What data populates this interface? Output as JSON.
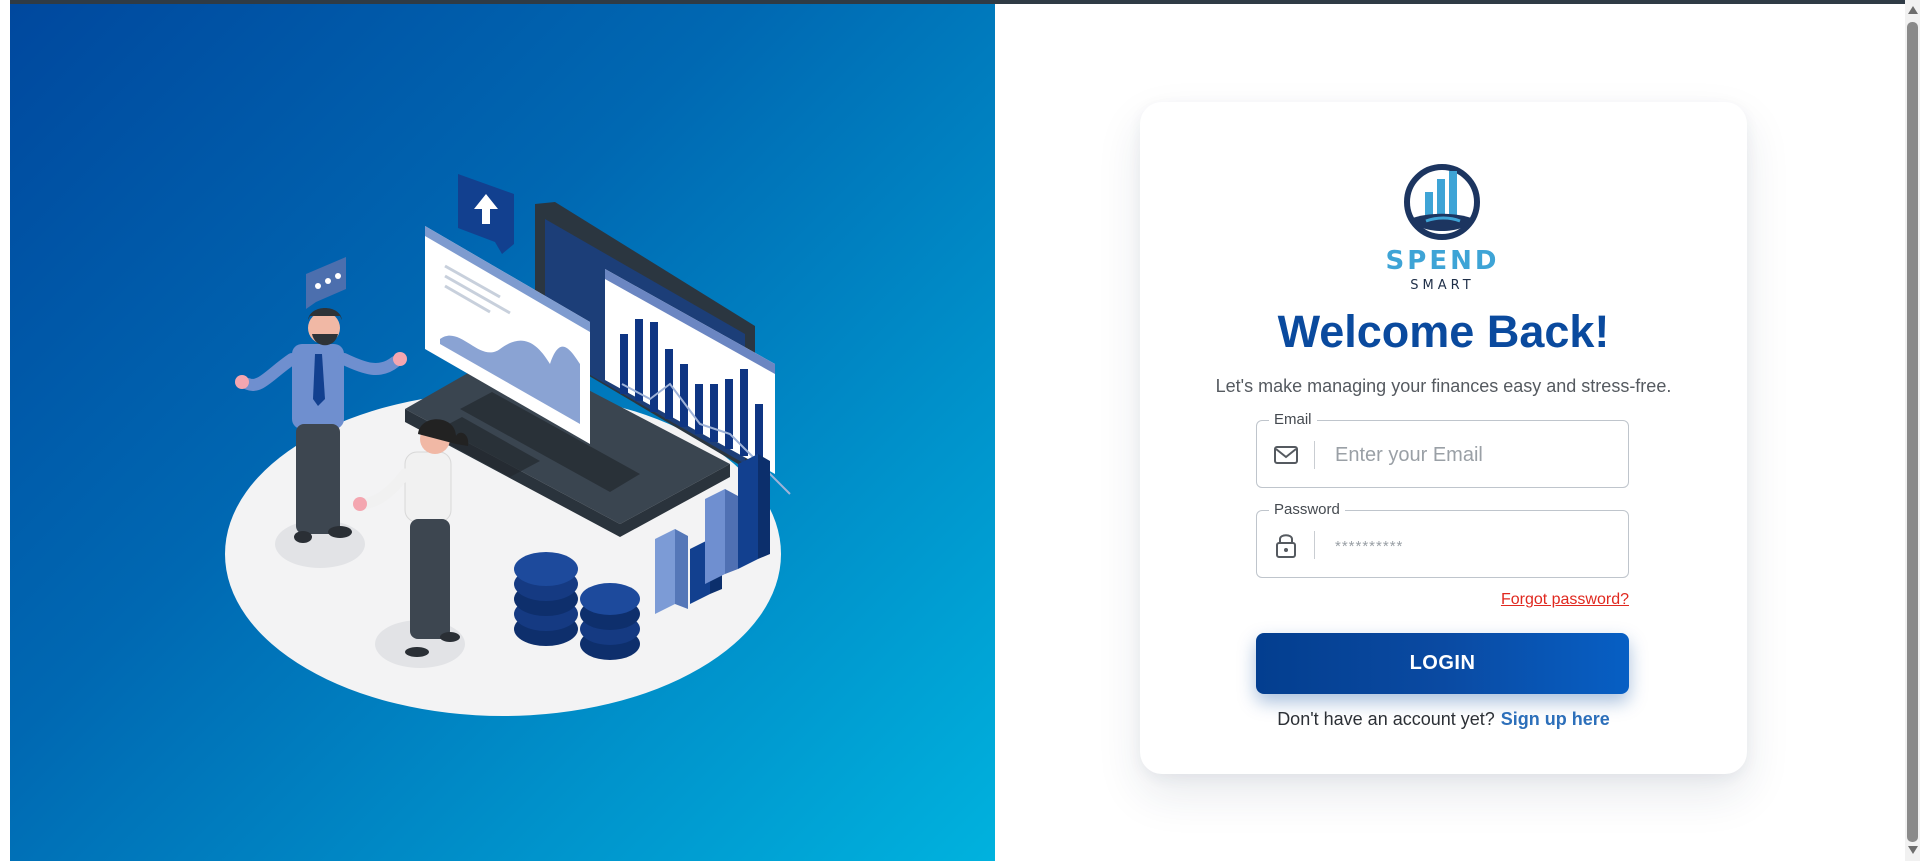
{
  "brand": {
    "name": "SPEND",
    "tagline": "SMART"
  },
  "login": {
    "title": "Welcome Back!",
    "subtitle": "Let's make managing your finances easy and stress-free.",
    "email_label": "Email",
    "email_placeholder": "Enter your Email",
    "password_label": "Password",
    "password_placeholder": "**********",
    "forgot_label": "Forgot password?",
    "login_label": "LOGIN",
    "no_account_text": "Don't have an account yet?",
    "signup_label": "Sign up here"
  },
  "icons": {
    "email": "envelope-icon",
    "password": "lock-icon"
  },
  "colors": {
    "primary": "#0a4a9e",
    "brand_light": "#3ea4d6",
    "link_red": "#e0281f",
    "link_blue": "#2c6fba",
    "hero_start": "#00489e",
    "hero_end": "#00b2de"
  }
}
